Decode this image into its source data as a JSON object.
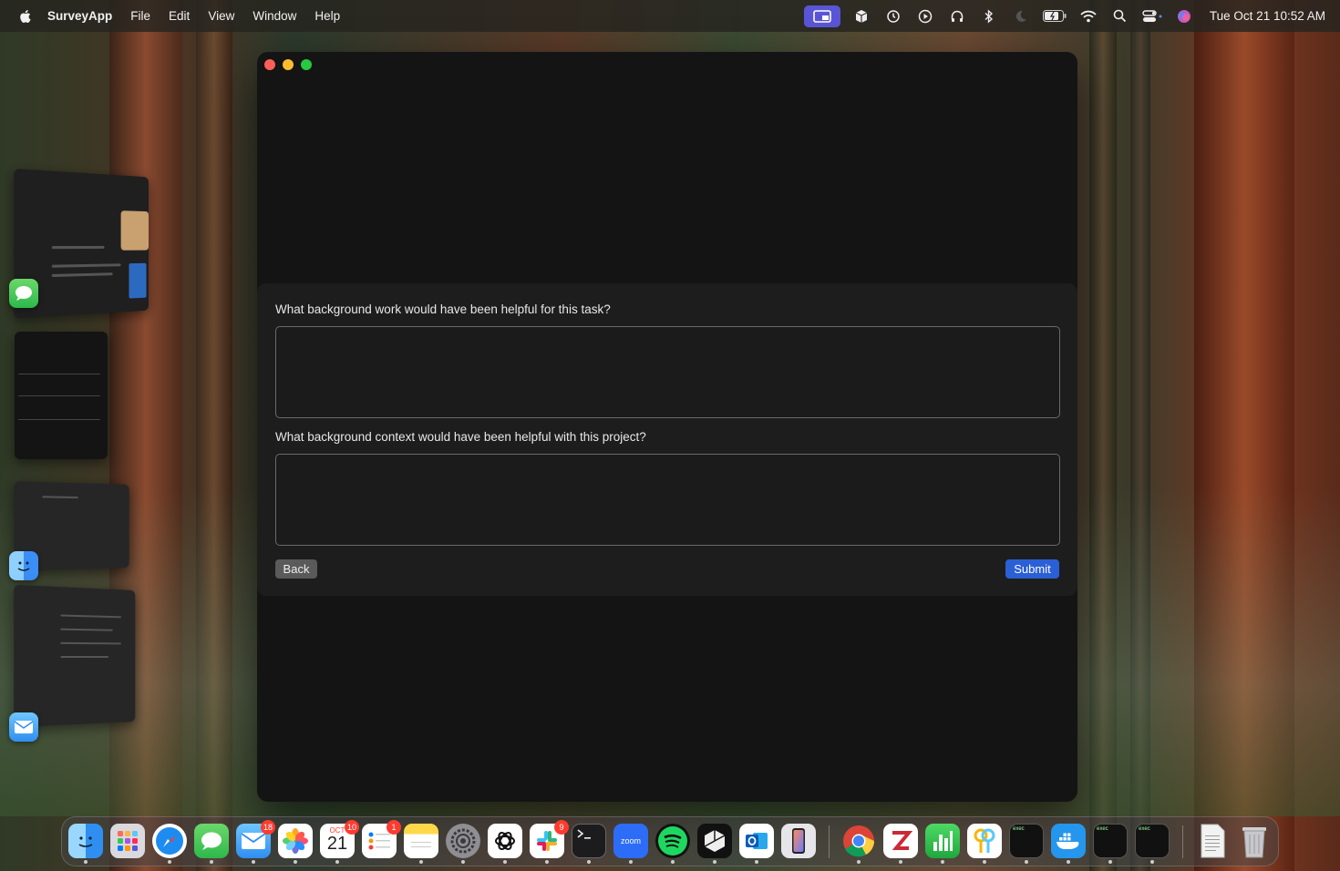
{
  "menubar": {
    "app_name": "SurveyApp",
    "menus": [
      "File",
      "Edit",
      "View",
      "Window",
      "Help"
    ],
    "clock": "Tue Oct 21  10:52 AM",
    "status_icons": [
      "screen-share-icon",
      "package-icon",
      "time-machine-icon",
      "play-icon",
      "headphones-icon",
      "bluetooth-icon",
      "moon-icon",
      "battery-icon",
      "wifi-icon",
      "search-icon",
      "control-center-icon",
      "siri-icon"
    ]
  },
  "survey": {
    "question1": "What background work would have been helpful for this task?",
    "answer1": "",
    "question2": "What background context would have been helpful with this project?",
    "answer2": "",
    "back_label": "Back",
    "submit_label": "Submit"
  },
  "dock": {
    "calendar_month": "OCT",
    "calendar_day": "21",
    "zoom_label": "zoom",
    "exec_label": "exec",
    "badges": {
      "mail": "18",
      "calendar": "10",
      "reminders": "1",
      "slack": "9"
    },
    "apps": [
      "Finder",
      "Launchpad",
      "Safari",
      "Messages",
      "Mail",
      "Photos",
      "Calendar",
      "Reminders",
      "Notes",
      "System Settings",
      "ChatGPT",
      "Slack",
      "Terminal",
      "Zoom",
      "Spotify",
      "Cursor",
      "Outlook",
      "iPhone Mirroring",
      "Chrome",
      "Zotero",
      "Numbers",
      "Keychain",
      "exec",
      "Docker",
      "exec",
      "exec",
      "Document",
      "Trash"
    ]
  },
  "colors": {
    "accent": "#2a5fd6",
    "window_bg": "#141414",
    "panel_bg": "#1d1d1d"
  }
}
